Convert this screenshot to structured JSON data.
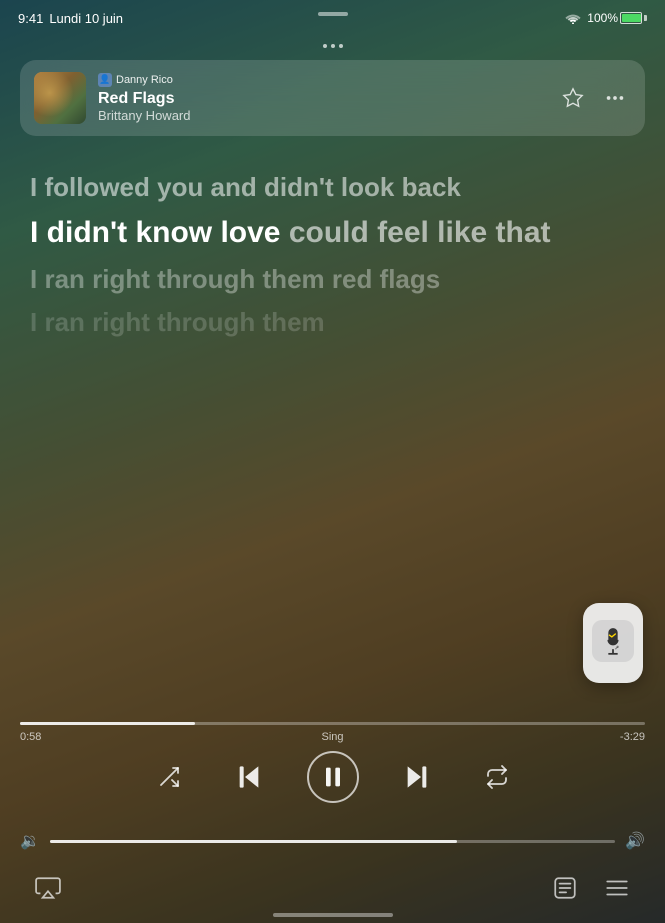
{
  "status_bar": {
    "time": "9:41",
    "date": "Lundi 10 juin",
    "wifi": "wifi",
    "battery_percent": "100%"
  },
  "now_playing": {
    "user": "Danny Rico",
    "title": "Red Flags",
    "artist": "Brittany Howard",
    "star_label": "star",
    "more_label": "more"
  },
  "lyrics": {
    "line1": "I followed you and didn't look back",
    "line2_part1": "I didn't know love ",
    "line2_part2": "could feel like that",
    "line3": "I ran right through them red flags",
    "line4": "I ran right through them"
  },
  "progress": {
    "current": "0:58",
    "mode": "Sing",
    "remaining": "-3:29",
    "fill_percent": 28
  },
  "volume": {
    "fill_percent": 72
  },
  "transport": {
    "shuffle": "⇄",
    "prev": "⏮",
    "pause": "⏸",
    "next": "⏭",
    "repeat": "↻"
  },
  "bottom_bar": {
    "airplay": "airplay",
    "lyrics": "lyrics",
    "queue": "queue"
  },
  "sing_mode": {
    "label": "sing"
  }
}
